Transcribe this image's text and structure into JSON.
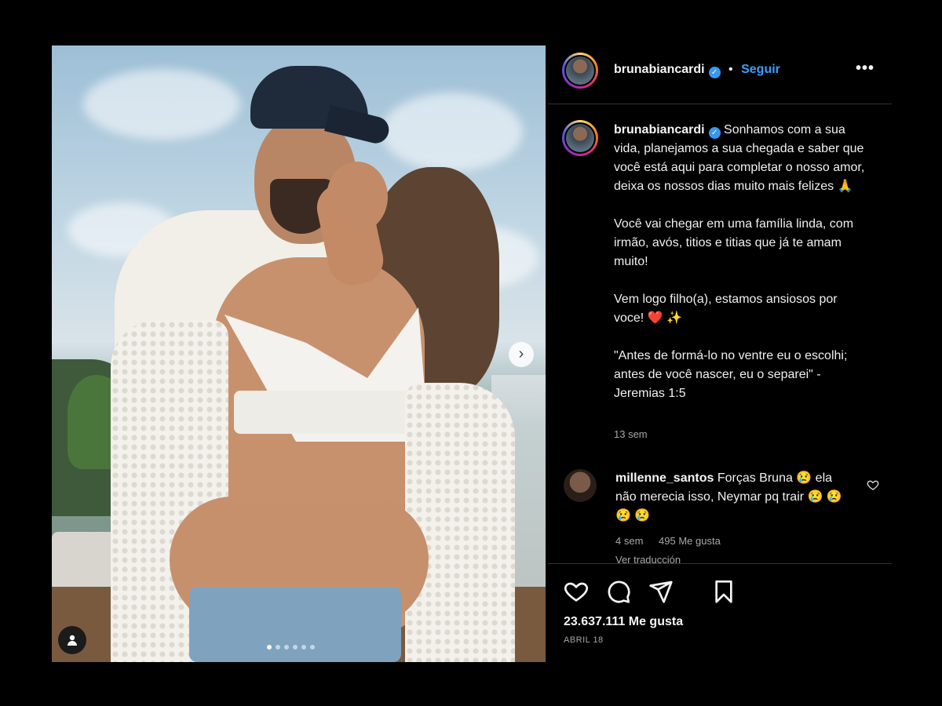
{
  "post": {
    "username": "brunabiancardi",
    "follow_label": "Seguir",
    "separator": "•",
    "more_label": "•••"
  },
  "caption": {
    "username": "brunabiancardi",
    "paragraphs": [
      "Sonhamos com a sua vida, planejamos a sua chegada e saber que você está aqui para completar o nosso amor, deixa os nossos dias muito mais felizes 🙏",
      "Você vai chegar em uma família linda, com irmão, avós, titios e titias que já te amam muito!",
      "Vem logo filho(a), estamos ansiosos por voce! ❤️ ✨",
      "\"Antes de formá-lo no ventre eu o escolhi; antes de você nascer, eu o separei\" - Jeremias 1:5"
    ],
    "time": "13 sem"
  },
  "comment": {
    "username": "millenne_santos",
    "text": "Forças Bruna 😢 ela não merecia isso, Neymar pq trair 😢 😢 😢 😢",
    "time": "4 sem",
    "likes": "495 Me gusta",
    "translate": "Ver traducción"
  },
  "engagement": {
    "likes": "23.637.111 Me gusta",
    "date": "ABRIL 18"
  },
  "carousel": {
    "total_slides": 6,
    "active_slide": 1
  },
  "colors": {
    "accent": "#3aa0ff",
    "verified": "#3897f0",
    "background": "#000000"
  },
  "icons": [
    "heart-icon",
    "comment-icon",
    "share-icon",
    "bookmark-icon",
    "verified-icon",
    "user-tag-icon",
    "chevron-right-icon",
    "more-icon"
  ]
}
